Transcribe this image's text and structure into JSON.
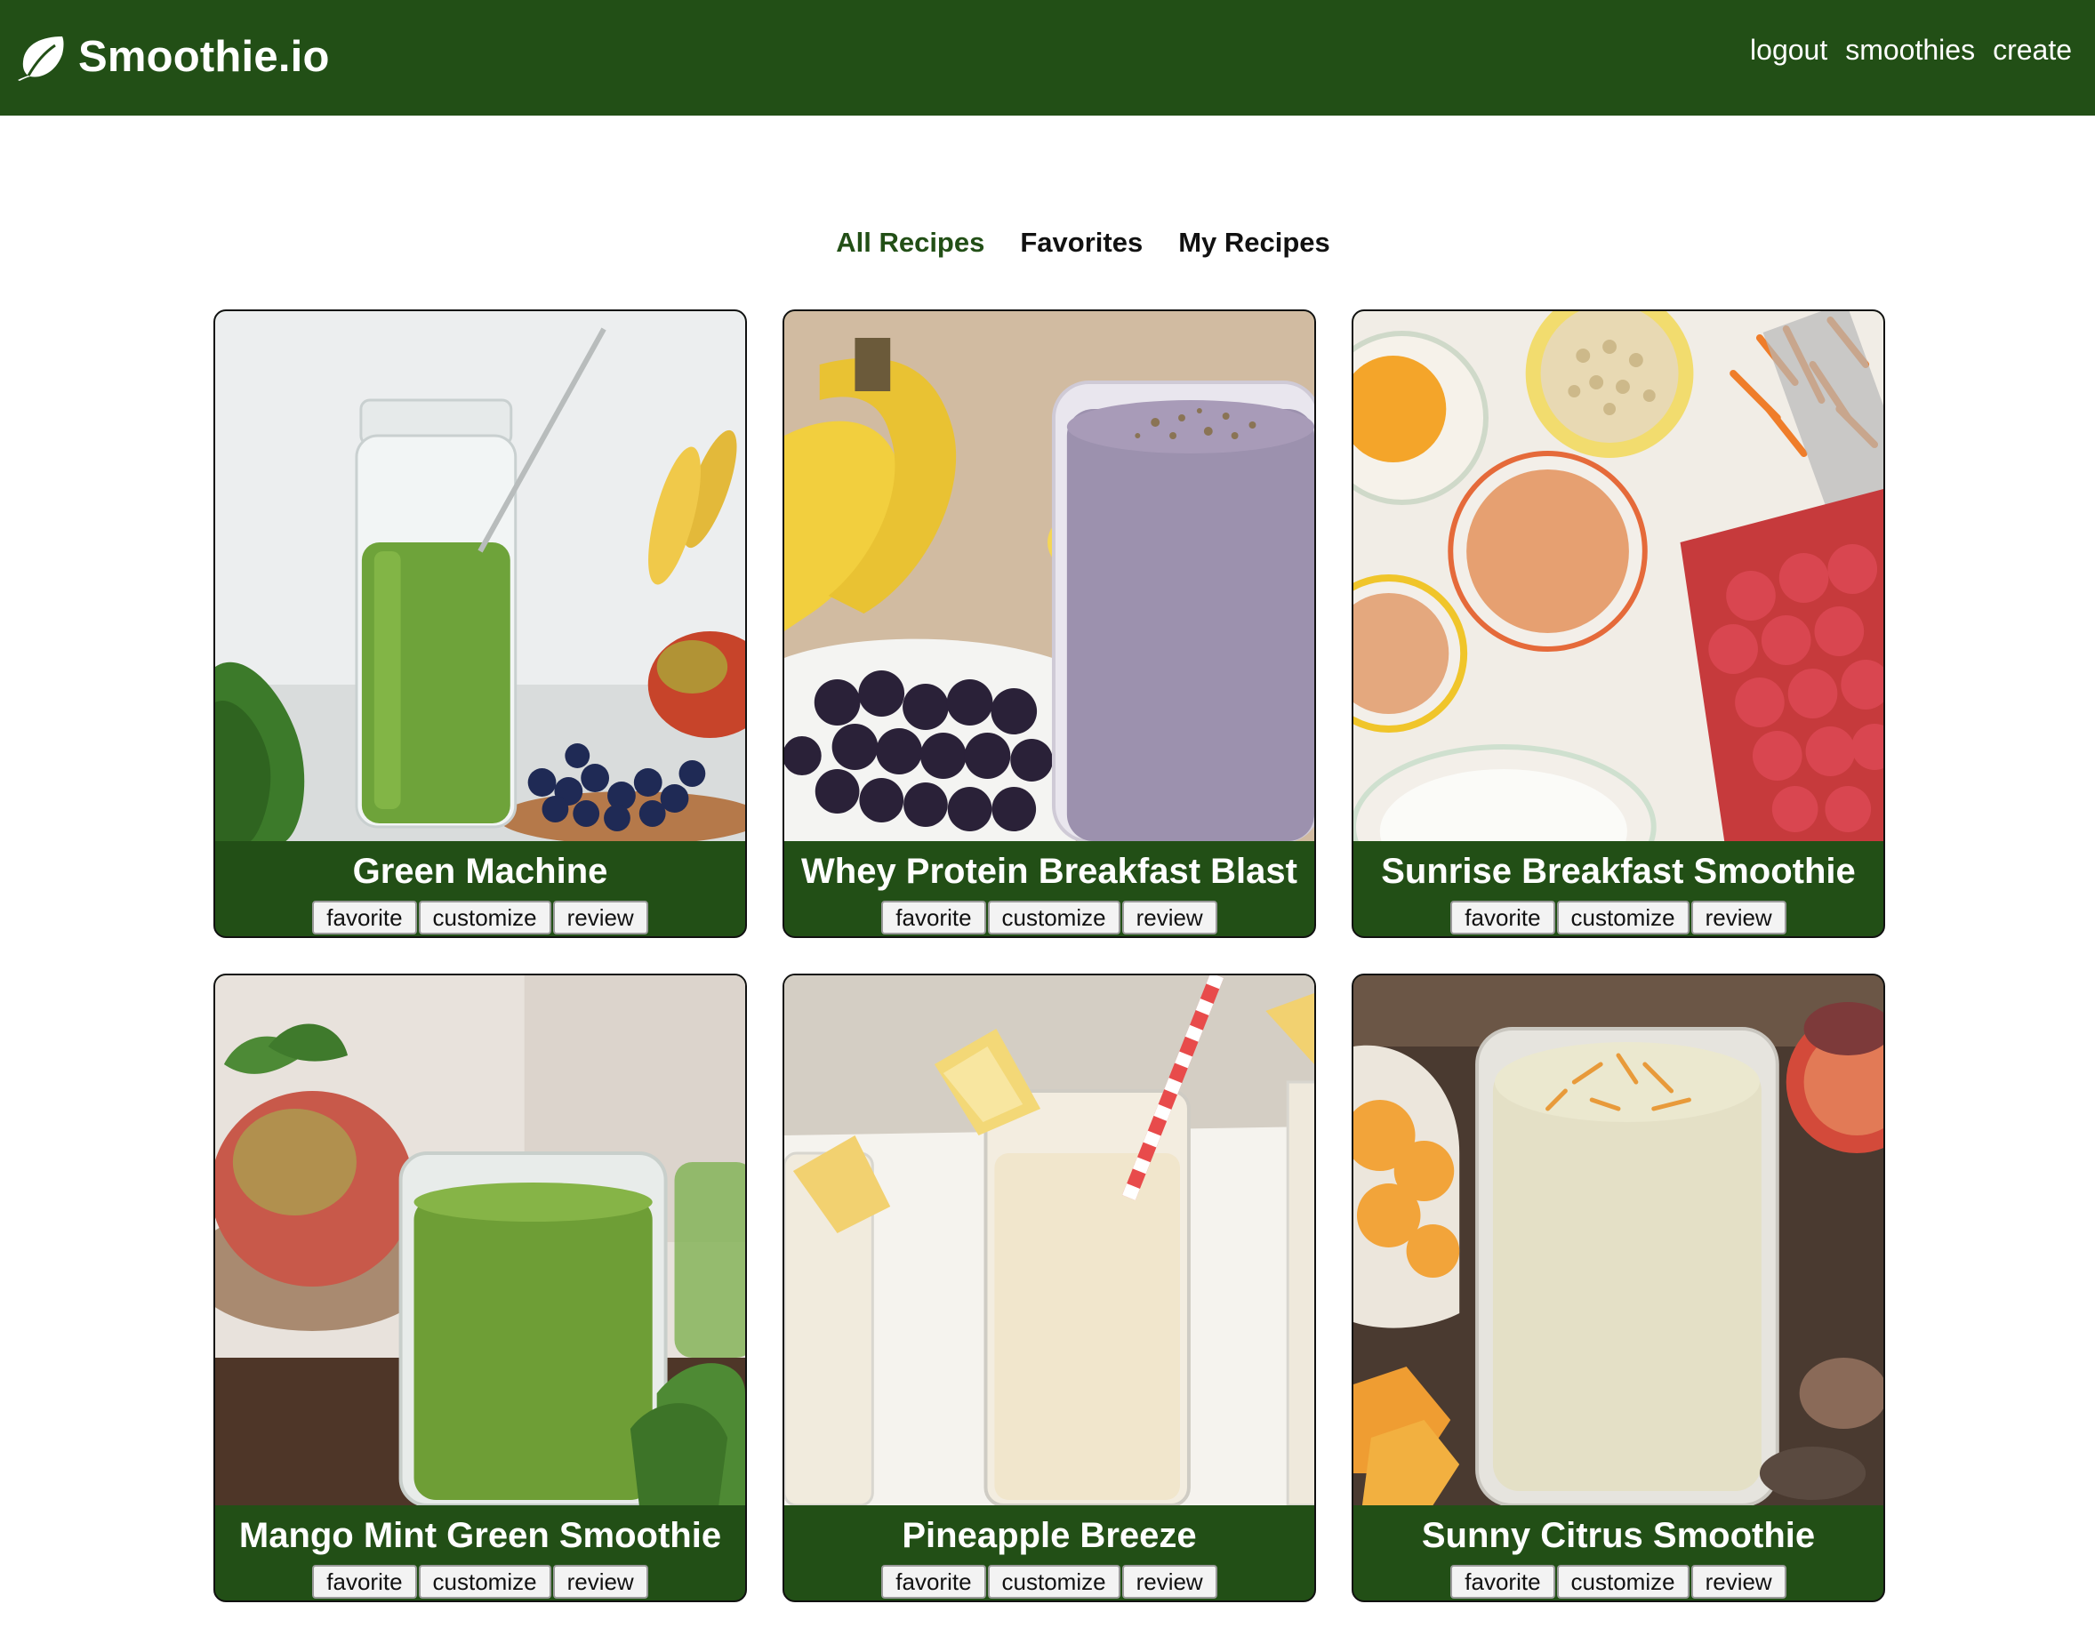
{
  "header": {
    "brand": "Smoothie.io",
    "nav": [
      "logout",
      "smoothies",
      "create"
    ],
    "brand_color": "#224f16"
  },
  "tabs": [
    {
      "label": "All Recipes",
      "active": true
    },
    {
      "label": "Favorites",
      "active": false
    },
    {
      "label": "My Recipes",
      "active": false
    }
  ],
  "recipes": [
    {
      "title": "Green Machine",
      "actions": [
        "favorite",
        "customize",
        "review"
      ]
    },
    {
      "title": "Whey Protein Breakfast Blast",
      "actions": [
        "favorite",
        "customize",
        "review"
      ]
    },
    {
      "title": "Sunrise Breakfast Smoothie",
      "actions": [
        "favorite",
        "customize",
        "review"
      ]
    },
    {
      "title": "Mango Mint Green Smoothie",
      "actions": [
        "favorite",
        "customize",
        "review"
      ]
    },
    {
      "title": "Pineapple Breeze",
      "actions": [
        "favorite",
        "customize",
        "review"
      ]
    },
    {
      "title": "Sunny Citrus Smoothie",
      "actions": [
        "favorite",
        "customize",
        "review"
      ]
    }
  ]
}
